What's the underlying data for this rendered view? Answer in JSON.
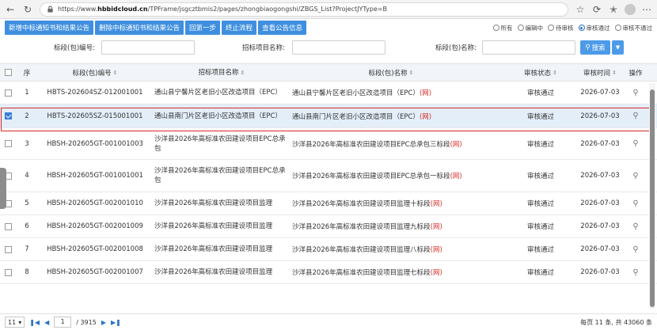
{
  "browser": {
    "url_prefix": "https://www.",
    "url_domain": "hbbidcloud.cn",
    "url_rest": "/TPFrame/jsgcztbmis2/pages/zhongbiaogongshi/ZBGS_List?ProjectJYType=B"
  },
  "toolbar": {
    "buttons": [
      "新增中标通知书和结果公告",
      "删除中标通知书和结果公告",
      "回第一步",
      "终止流程",
      "查看公告信息"
    ],
    "radios": [
      {
        "label": "所有",
        "checked": false
      },
      {
        "label": "编辑中",
        "checked": false
      },
      {
        "label": "待审核",
        "checked": false
      },
      {
        "label": "审核通过",
        "checked": true
      },
      {
        "label": "审核不通过",
        "checked": false
      }
    ]
  },
  "search": {
    "section_code_label": "标段(包)编号:",
    "project_name_label": "招标项目名称:",
    "section_name_label": "标段(包)名称:",
    "section_code_value": "",
    "project_name_value": "",
    "section_name_value": "",
    "search_label": "搜索"
  },
  "table": {
    "headers": {
      "seq": "序",
      "code": "标段(包)编号",
      "project": "招标项目名称",
      "section": "标段(包)名称",
      "status": "审核状态",
      "time": "审核时间",
      "op": "操作"
    },
    "web_tag": "(网)",
    "rows": [
      {
        "seq": "1",
        "code": "HBTS-202604SZ-012001001",
        "project": "通山县宁馨片区老旧小区改造项目（EPC）",
        "section": "通山县宁馨片区老旧小区改造项目（EPC）",
        "status": "审核通过",
        "time": "2026-07-03",
        "checked": false
      },
      {
        "seq": "2",
        "code": "HBTS-202605SZ-015001001",
        "project": "通山县南门片区老旧小区改造项目（EPC）",
        "section": "通山县南门片区老旧小区改造项目（EPC）",
        "status": "审核通过",
        "time": "2026-07-03",
        "checked": true
      },
      {
        "seq": "3",
        "code": "HBSH-202605GT-001001003",
        "project": "沙洋县2026年高标准农田建设项目EPC总承包",
        "section": "沙洋县2026年高标准农田建设项目EPC总承包三标段",
        "status": "审核通过",
        "time": "2026-07-03",
        "checked": false
      },
      {
        "seq": "4",
        "code": "HBSH-202605GT-001001001",
        "project": "沙洋县2026年高标准农田建设项目EPC总承包",
        "section": "沙洋县2026年高标准农田建设项目EPC总承包一标段",
        "status": "审核通过",
        "time": "2026-07-03",
        "checked": false
      },
      {
        "seq": "5",
        "code": "HBSH-202605GT-002001010",
        "project": "沙洋县2026年高标准农田建设项目监理",
        "section": "沙洋县2026年高标准农田建设项目监理十标段",
        "status": "审核通过",
        "time": "2026-07-03",
        "checked": false
      },
      {
        "seq": "6",
        "code": "HBSH-202605GT-002001009",
        "project": "沙洋县2026年高标准农田建设项目监理",
        "section": "沙洋县2026年高标准农田建设项目监理九标段",
        "status": "审核通过",
        "time": "2026-07-03",
        "checked": false
      },
      {
        "seq": "7",
        "code": "HBSH-202605GT-002001008",
        "project": "沙洋县2026年高标准农田建设项目监理",
        "section": "沙洋县2026年高标准农田建设项目监理八标段",
        "status": "审核通过",
        "time": "2026-07-03",
        "checked": false
      },
      {
        "seq": "8",
        "code": "HBSH-202605GT-002001007",
        "project": "沙洋县2026年高标准农田建设项目监理",
        "section": "沙洋县2026年高标准农田建设项目监理七标段",
        "status": "审核通过",
        "time": "2026-07-03",
        "checked": false
      }
    ]
  },
  "pager": {
    "page_size": "11",
    "current_page": "1",
    "total_pages": "/ 3915",
    "summary": "每页 11 条, 共 43060 条"
  }
}
